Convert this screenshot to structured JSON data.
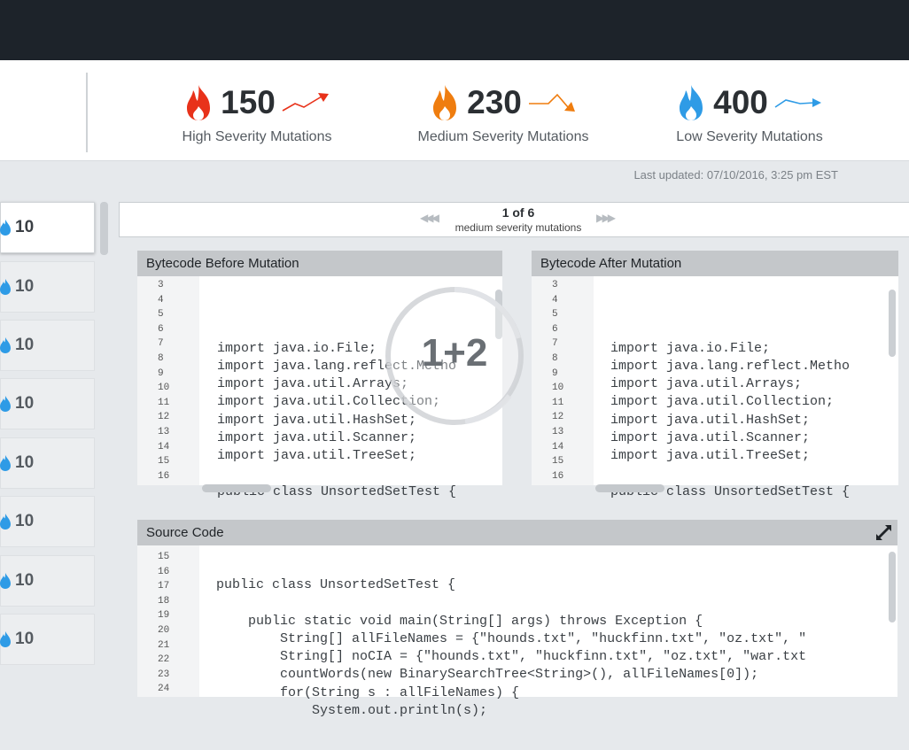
{
  "stats": [
    {
      "value": "150",
      "label": "High Severity Mutations",
      "color": "#e8321a",
      "trend": "up"
    },
    {
      "value": "230",
      "label": "Medium Severity Mutations",
      "color": "#ef7d0f",
      "trend": "down"
    },
    {
      "value": "400",
      "label": "Low Severity Mutations",
      "color": "#2e9be6",
      "trend": "flat"
    }
  ],
  "last_updated": "Last updated: 07/10/2016, 3:25 pm EST",
  "list": [
    {
      "count": "10"
    },
    {
      "count": "10"
    },
    {
      "count": "10"
    },
    {
      "count": "10"
    },
    {
      "count": "10"
    },
    {
      "count": "10"
    },
    {
      "count": "10"
    },
    {
      "count": "10"
    }
  ],
  "pager": {
    "title": "1 of 6",
    "subtitle": "medium severity mutations"
  },
  "before": {
    "title": "Bytecode Before Mutation",
    "line_numbers": [
      "3",
      "4",
      "5",
      "6",
      "7",
      "8",
      "9",
      "10",
      "11",
      "12",
      "13",
      "14",
      "15",
      "16"
    ],
    "code": [
      "",
      "",
      "import java.io.File;",
      "import java.lang.reflect.Metho",
      "import java.util.Arrays;",
      "import java.util.Collection;",
      "import java.util.HashSet;",
      "import java.util.Scanner;",
      "import java.util.TreeSet;",
      "",
      "public class UnsortedSetTest {"
    ]
  },
  "after": {
    "title": "Bytecode After Mutation",
    "line_numbers": [
      "3",
      "4",
      "5",
      "6",
      "7",
      "8",
      "9",
      "10",
      "11",
      "12",
      "13",
      "14",
      "15",
      "16"
    ],
    "code": [
      "",
      "",
      "import java.io.File;",
      "import java.lang.reflect.Metho",
      "import java.util.Arrays;",
      "import java.util.Collection;",
      "import java.util.HashSet;",
      "import java.util.Scanner;",
      "import java.util.TreeSet;",
      "",
      "public class UnsortedSetTest {"
    ]
  },
  "source": {
    "title": "Source Code",
    "line_numbers": [
      "15",
      "16",
      "17",
      "18",
      "19",
      "20",
      "21",
      "22",
      "23",
      "24"
    ],
    "code": [
      "public class UnsortedSetTest {",
      "",
      "    public static void main(String[] args) throws Exception {",
      "        String[] allFileNames = {\"hounds.txt\", \"huckfinn.txt\", \"oz.txt\", \"",
      "        String[] noCIA = {\"hounds.txt\", \"huckfinn.txt\", \"oz.txt\", \"war.txt",
      "        countWords(new BinarySearchTree<String>(), allFileNames[0]);",
      "        for(String s : allFileNames) {",
      "            System.out.println(s);"
    ]
  },
  "spinner": {
    "text": "1+2"
  },
  "icons": {
    "flame": "flame-icon",
    "expand": "expand-icon"
  }
}
